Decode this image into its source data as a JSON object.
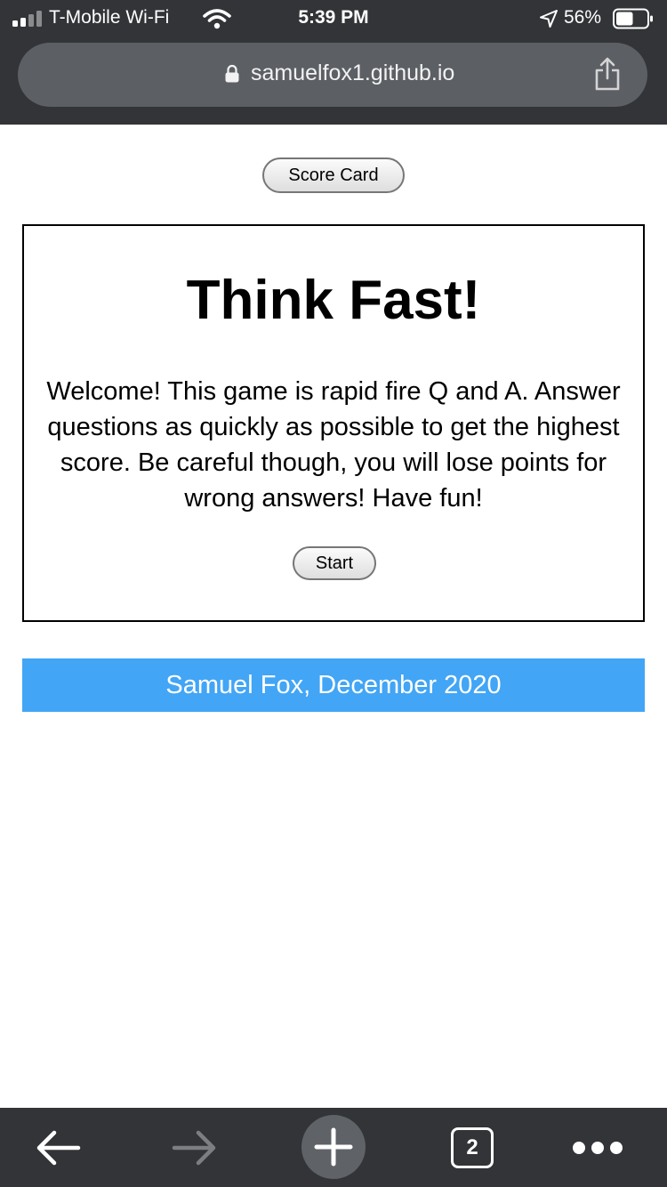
{
  "status_bar": {
    "carrier": "T-Mobile Wi-Fi",
    "time": "5:39 PM",
    "battery": "56%",
    "battery_level": 0.56
  },
  "browser": {
    "url": "samuelfox1.github.io",
    "tab_count": "2"
  },
  "page": {
    "score_card_label": "Score Card",
    "title": "Think Fast!",
    "intro": "Welcome! This game is rapid fire Q and A. Answer questions as quickly as possible to get the highest score. Be careful though, you will lose points for wrong answers! Have fun!",
    "start_label": "Start",
    "footer": "Samuel Fox, December 2020"
  },
  "colors": {
    "chrome": "#323437",
    "url_bar": "#5c5f64",
    "footer_bg": "#42a5f5",
    "footer_text": "#ffffff"
  },
  "icons": {
    "status": [
      "signal-icon",
      "wifi-icon",
      "location-arrow-icon",
      "battery-icon"
    ],
    "url_bar": [
      "lock-icon",
      "share-icon"
    ],
    "toolbar": [
      "back-arrow-icon",
      "forward-arrow-icon",
      "plus-icon",
      "tabs-icon",
      "more-icon"
    ]
  }
}
